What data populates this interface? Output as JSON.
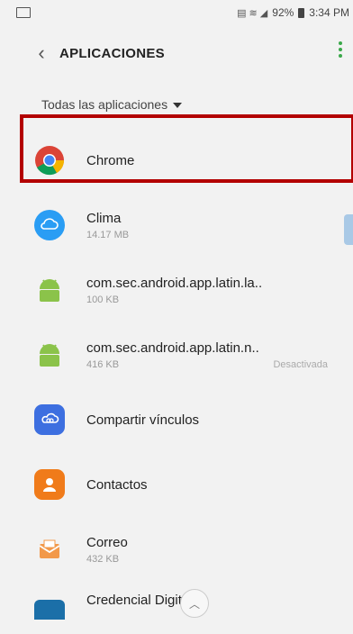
{
  "status_bar": {
    "time": "3:34 PM",
    "battery": "92%"
  },
  "app_bar": {
    "title": "APLICACIONES",
    "back_icon": "chevron-left-icon",
    "more_icon": "more-vertical-icon"
  },
  "filter": {
    "label": "Todas las aplicaciones"
  },
  "apps": [
    {
      "name": "Chrome",
      "size": "",
      "status": "",
      "icon": "chrome-icon"
    },
    {
      "name": "Clima",
      "size": "14.17 MB",
      "status": "",
      "icon": "weather-icon"
    },
    {
      "name": "com.sec.android.app.latin.la..",
      "size": "100 KB",
      "status": "",
      "icon": "android-icon"
    },
    {
      "name": "com.sec.android.app.latin.n..",
      "size": "416 KB",
      "status": "Desactivada",
      "icon": "android-icon"
    },
    {
      "name": "Compartir vínculos",
      "size": "",
      "status": "",
      "icon": "share-link-icon"
    },
    {
      "name": "Contactos",
      "size": "",
      "status": "",
      "icon": "contacts-icon"
    },
    {
      "name": "Correo",
      "size": "432 KB",
      "status": "",
      "icon": "email-icon"
    },
    {
      "name": "Credencial Digital",
      "size": "",
      "status": "",
      "icon": "credential-icon"
    }
  ],
  "colors": {
    "highlight": "#b30000",
    "accent": "#3aa84a"
  }
}
